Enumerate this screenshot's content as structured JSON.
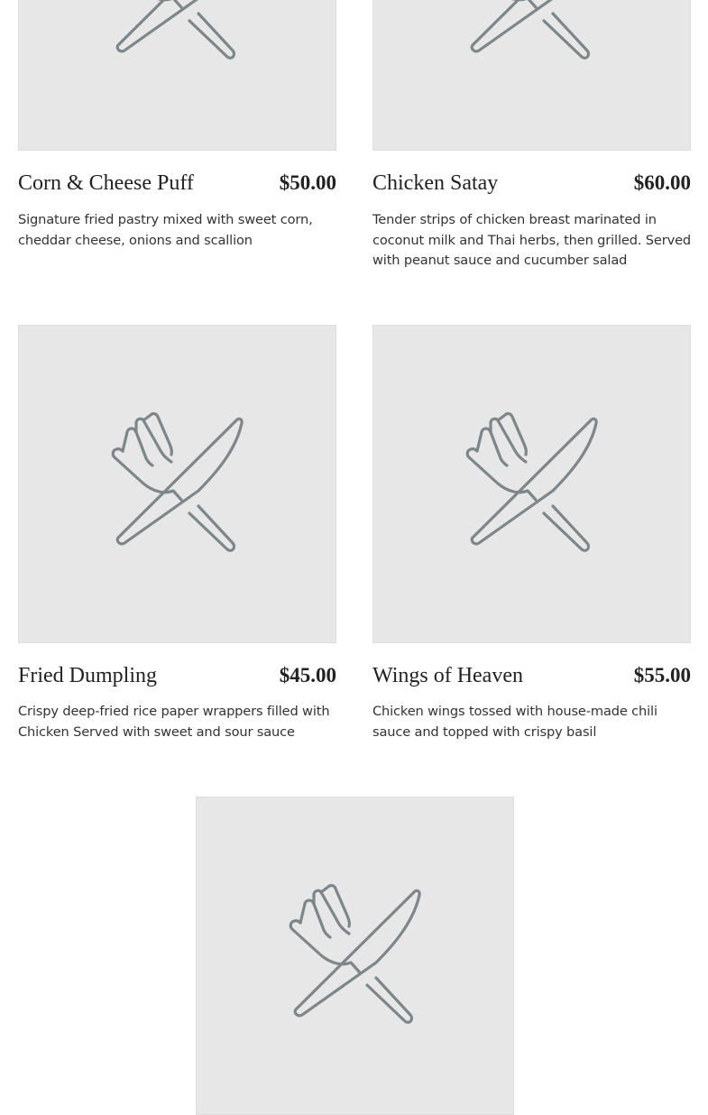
{
  "icon_name": "fork-knife-icon",
  "colors": {
    "thumb_bg": "#e7e7e7",
    "icon_stroke": "#7d8689",
    "text": "#222222"
  },
  "menu_items": [
    {
      "name": "Corn & Cheese Puff",
      "price": "$50.00",
      "description": "Signature fried pastry mixed with sweet corn, cheddar cheese, onions and scallion"
    },
    {
      "name": "Chicken Satay",
      "price": "$60.00",
      "description": "Tender strips of chicken breast marinated in coconut milk and Thai herbs, then grilled. Served with peanut sauce and cucumber salad"
    },
    {
      "name": "Fried Dumpling",
      "price": "$45.00",
      "description": "Crispy deep-fried rice paper wrappers filled with Chicken Served with sweet and sour sauce"
    },
    {
      "name": "Wings of Heaven",
      "price": "$55.00",
      "description": "Chicken wings tossed with house-made chili sauce and topped with crispy basil"
    },
    {
      "name": "",
      "price": "",
      "description": ""
    }
  ]
}
